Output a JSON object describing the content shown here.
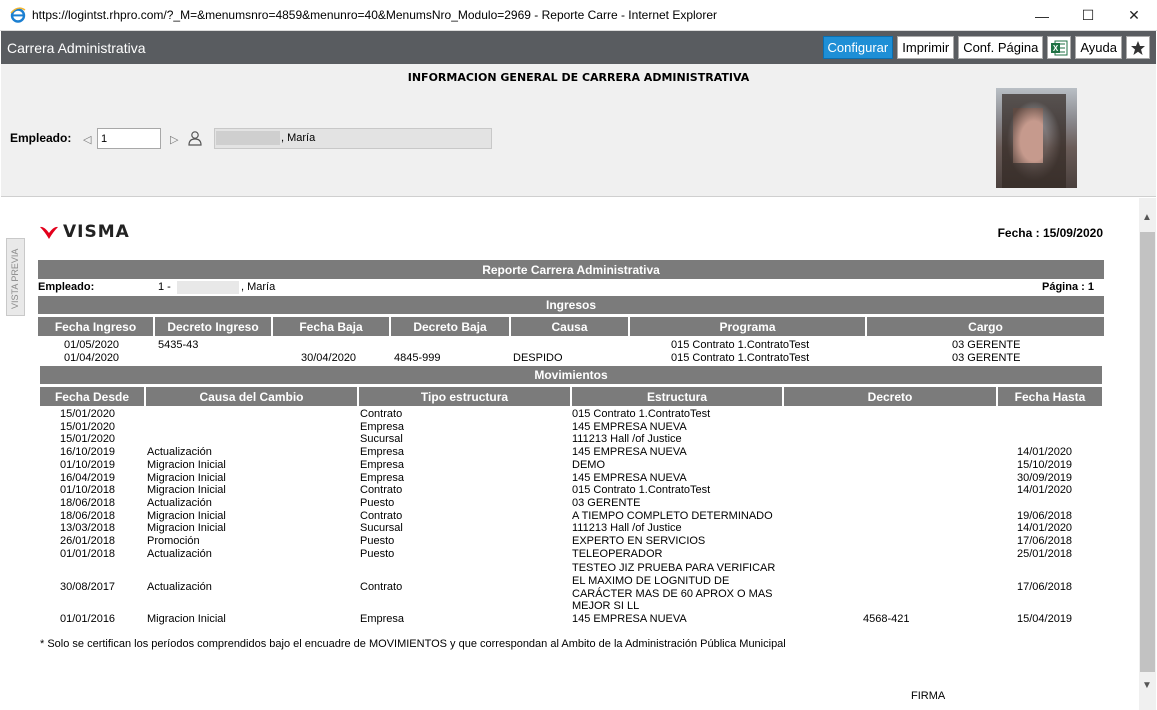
{
  "window": {
    "title": "https://logintst.rhpro.com/?_M=&menumsnro=4859&menunro=40&MenumsNro_Modulo=2969 - Reporte Carre - Internet Explorer",
    "minimize": "—",
    "maximize": "☐",
    "close": "✕"
  },
  "app": {
    "title": "Carrera Administrativa",
    "toolbar": {
      "configurar": "Configurar",
      "imprimir": "Imprimir",
      "conf_pagina": "Conf. Página",
      "excel_icon": "excel-icon",
      "ayuda": "Ayuda",
      "star_icon": "star-icon"
    }
  },
  "filter": {
    "title": "INFORMACION GENERAL DE CARRERA ADMINISTRATIVA",
    "employee_label": "Empleado:",
    "employee_value": "1",
    "employee_name": ", María"
  },
  "report": {
    "side_tab": "VISTA PREVIA",
    "logo_text": "VISMA",
    "fecha": "Fecha : 15/09/2020",
    "title": "Reporte Carrera Administrativa",
    "employee_label": "Empleado:",
    "employee_prefix": "1 -",
    "employee_name": ", María",
    "pagina": "Página : 1",
    "ingresos_title": "Ingresos",
    "ingresos_headers": [
      "Fecha Ingreso",
      "Decreto Ingreso",
      "Fecha Baja",
      "Decreto Baja",
      "Causa",
      "Programa",
      "Cargo"
    ],
    "ingresos_rows": [
      {
        "fecha_ingreso": "01/05/2020",
        "decreto_ingreso": "5435-43",
        "fecha_baja": "",
        "decreto_baja": "",
        "causa": "",
        "programa": "015 Contrato 1.ContratoTest",
        "cargo": "03 GERENTE"
      },
      {
        "fecha_ingreso": "01/04/2020",
        "decreto_ingreso": "",
        "fecha_baja": "30/04/2020",
        "decreto_baja": "4845-999",
        "causa": "DESPIDO",
        "programa": "015 Contrato 1.ContratoTest",
        "cargo": "03 GERENTE"
      }
    ],
    "movimientos_title": "Movimientos",
    "movimientos_headers": [
      "Fecha Desde",
      "Causa del Cambio",
      "Tipo estructura",
      "Estructura",
      "Decreto",
      "Fecha Hasta"
    ],
    "movimientos_rows": [
      {
        "desde": "15/01/2020",
        "causa": "",
        "tipo": "Contrato",
        "estructura": "015 Contrato 1.ContratoTest",
        "decreto": "",
        "hasta": ""
      },
      {
        "desde": "15/01/2020",
        "causa": "",
        "tipo": "Empresa",
        "estructura": "145 EMPRESA NUEVA",
        "decreto": "",
        "hasta": ""
      },
      {
        "desde": "15/01/2020",
        "causa": "",
        "tipo": "Sucursal",
        "estructura": "111213 Hall /of Justice",
        "decreto": "",
        "hasta": ""
      },
      {
        "desde": "16/10/2019",
        "causa": "Actualización",
        "tipo": "Empresa",
        "estructura": "145 EMPRESA NUEVA",
        "decreto": "",
        "hasta": "14/01/2020"
      },
      {
        "desde": "01/10/2019",
        "causa": "Migracion Inicial",
        "tipo": "Empresa",
        "estructura": "DEMO",
        "decreto": "",
        "hasta": "15/10/2019"
      },
      {
        "desde": "16/04/2019",
        "causa": "Migracion Inicial",
        "tipo": "Empresa",
        "estructura": "145 EMPRESA NUEVA",
        "decreto": "",
        "hasta": "30/09/2019"
      },
      {
        "desde": "01/10/2018",
        "causa": "Migracion Inicial",
        "tipo": "Contrato",
        "estructura": "015 Contrato 1.ContratoTest",
        "decreto": "",
        "hasta": "14/01/2020"
      },
      {
        "desde": "18/06/2018",
        "causa": "Actualización",
        "tipo": "Puesto",
        "estructura": "03 GERENTE",
        "decreto": "",
        "hasta": ""
      },
      {
        "desde": "18/06/2018",
        "causa": "Migracion Inicial",
        "tipo": "Contrato",
        "estructura": "A TIEMPO COMPLETO DETERMINADO",
        "decreto": "",
        "hasta": "19/06/2018"
      },
      {
        "desde": "13/03/2018",
        "causa": "Migracion Inicial",
        "tipo": "Sucursal",
        "estructura": "111213 Hall /of Justice",
        "decreto": "",
        "hasta": "14/01/2020"
      },
      {
        "desde": "26/01/2018",
        "causa": "Promoción",
        "tipo": "Puesto",
        "estructura": "EXPERTO EN SERVICIOS",
        "decreto": "",
        "hasta": "17/06/2018"
      },
      {
        "desde": "01/01/2018",
        "causa": "Actualización",
        "tipo": "Puesto",
        "estructura": "TELEOPERADOR",
        "decreto": "",
        "hasta": "25/01/2018"
      }
    ],
    "multiline_row": {
      "desde": "30/08/2017",
      "causa": "Actualización",
      "tipo": "Contrato",
      "estructura_lines": [
        "TESTEO JIZ PRUEBA PARA VERIFICAR",
        "EL MAXIMO DE LOGNITUD DE",
        "CARÁCTER MAS DE 60 APROX O MAS",
        "MEJOR SI LL"
      ],
      "decreto": "",
      "hasta": "17/06/2018"
    },
    "last_row": {
      "desde": "01/01/2016",
      "causa": "Migracion Inicial",
      "tipo": "Empresa",
      "estructura": "145 EMPRESA NUEVA",
      "decreto": "4568-421",
      "hasta": "15/04/2019"
    },
    "footnote": "* Solo se certifican los períodos comprendidos bajo el encuadre de MOVIMIENTOS y que correspondan al Ambito de la Administración Pública Municipal",
    "firma": "FIRMA"
  }
}
